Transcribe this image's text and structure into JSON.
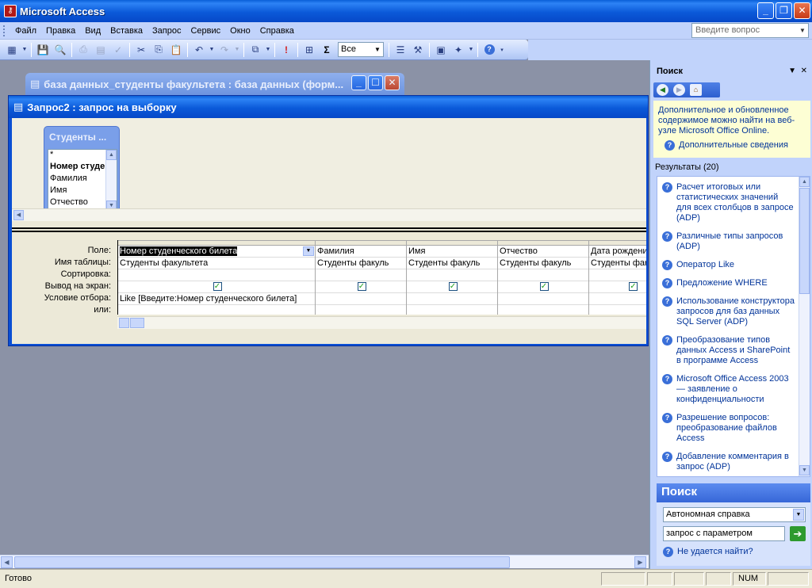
{
  "app": {
    "title": "Microsoft Access",
    "minimize": "_",
    "restore": "❐",
    "close": "✕"
  },
  "menu": {
    "items": [
      {
        "label": "Файл"
      },
      {
        "label": "Правка"
      },
      {
        "label": "Вид"
      },
      {
        "label": "Вставка"
      },
      {
        "label": "Запрос"
      },
      {
        "label": "Сервис"
      },
      {
        "label": "Окно"
      },
      {
        "label": "Справка"
      }
    ],
    "help_placeholder": "Введите вопрос"
  },
  "toolbar": {
    "top_values": "Все",
    "sum_symbol": "Σ",
    "run_symbol": "!"
  },
  "db_window": {
    "title": "база данных_студенты факультета : база данных (форм..."
  },
  "query_window": {
    "title": "Запрос2 : запрос на выборку",
    "field_list": {
      "title": "Студенты ...",
      "fields": [
        "*",
        "Номер студе",
        "Фамилия",
        "Имя",
        "Отчество"
      ]
    },
    "row_labels": [
      "Поле:",
      "Имя таблицы:",
      "Сортировка:",
      "Вывод на экран:",
      "Условие отбора:",
      "или:"
    ],
    "columns": [
      {
        "field": "Номер студенческого билета",
        "table": "Студенты факультета",
        "sort": "",
        "show": true,
        "criteria": "Like [Введите:Номер студенческого билета]",
        "or": ""
      },
      {
        "field": "Фамилия",
        "table": "Студенты факуль",
        "sort": "",
        "show": true,
        "criteria": "",
        "or": ""
      },
      {
        "field": "Имя",
        "table": "Студенты факуль",
        "sort": "",
        "show": true,
        "criteria": "",
        "or": ""
      },
      {
        "field": "Отчество",
        "table": "Студенты факуль",
        "sort": "",
        "show": true,
        "criteria": "",
        "or": ""
      },
      {
        "field": "Дата рождени",
        "table": "Студенты фак",
        "sort": "",
        "show": true,
        "criteria": "",
        "or": ""
      }
    ]
  },
  "taskpane": {
    "title": "Поиск",
    "info_text": "Дополнительное и обновленное содержимое можно найти на веб-узле Microsoft Office Online.",
    "more_info": "Дополнительные сведения",
    "results_label": "Результаты (20)",
    "results": [
      "Расчет итоговых или статистических значений для всех столбцов в запросе (ADP)",
      "Различные типы запросов (ADP)",
      "Оператор Like",
      "Предложение WHERE",
      "Использование конструктора запросов для баз данных SQL Server (ADP)",
      "Преобразование типов данных Access и SharePoint в программе Access",
      "Microsoft Office Access 2003 — заявление о конфиденциальности",
      "Разрешение вопросов: преобразование файлов Access",
      "Добавление комментария в запрос (ADP)"
    ],
    "search_title": "Поиск",
    "search_scope": "Автономная справка",
    "search_query": "запрос с параметром",
    "cant_find": "Не удается найти?"
  },
  "status": {
    "text": "Готово",
    "num": "NUM"
  }
}
